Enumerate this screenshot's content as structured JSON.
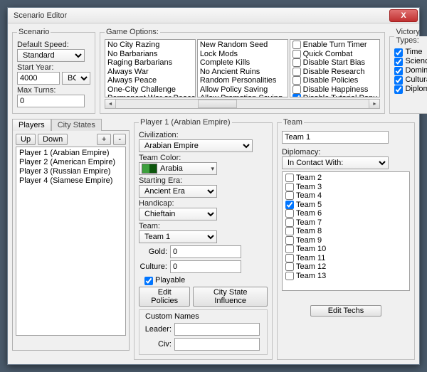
{
  "window": {
    "title": "Scenario Editor",
    "close": "X"
  },
  "scenario": {
    "legend": "Scenario",
    "default_speed_label": "Default Speed:",
    "default_speed": "Standard",
    "start_year_label": "Start Year:",
    "start_year": "4000",
    "era_select": "BC",
    "max_turns_label": "Max Turns:",
    "max_turns": "0"
  },
  "game_options": {
    "legend": "Game Options:",
    "col1": [
      "No City Razing",
      "No Barbarians",
      "Raging Barbarians",
      "Always War",
      "Always Peace",
      "One-City Challenge",
      "Permanent War or Peace"
    ],
    "col2": [
      "New Random Seed",
      "Lock Mods",
      "Complete Kills",
      "No Ancient Ruins",
      "Random Personalities",
      "Allow Policy Saving",
      "Allow Promotion Saving"
    ],
    "col3": [
      {
        "label": "Enable Turn Timer",
        "checked": false
      },
      {
        "label": "Quick Combat",
        "checked": false
      },
      {
        "label": "Disable Start Bias",
        "checked": false
      },
      {
        "label": "Disable Research",
        "checked": false
      },
      {
        "label": "Disable Policies",
        "checked": false
      },
      {
        "label": "Disable Happiness",
        "checked": false
      },
      {
        "label": "Disable Tutorial Popu",
        "checked": true
      }
    ]
  },
  "victory": {
    "legend": "Victory Types:",
    "items": [
      {
        "label": "Time",
        "checked": true
      },
      {
        "label": "Science",
        "checked": true
      },
      {
        "label": "Domination",
        "checked": true
      },
      {
        "label": "Cultural",
        "checked": true
      },
      {
        "label": "Diplomatic",
        "checked": true
      }
    ]
  },
  "players_panel": {
    "tab_players": "Players",
    "tab_citystates": "City States",
    "up": "Up",
    "down": "Down",
    "plus": "+",
    "minus": "-",
    "list": [
      "Player 1 (Arabian Empire)",
      "Player 2 (American Empire)",
      "Player 3 (Russian Empire)",
      "Player 4 (Siamese Empire)"
    ]
  },
  "player_detail": {
    "legend": "Player 1 (Arabian Empire)",
    "civ_label": "Civilization:",
    "civ": "Arabian Empire",
    "teamcolor_label": "Team Color:",
    "teamcolor_name": "Arabia",
    "era_label": "Starting Era:",
    "era": "Ancient Era",
    "handicap_label": "Handicap:",
    "handicap": "Chieftain",
    "team_label": "Team:",
    "team": "Team 1",
    "gold_label": "Gold:",
    "gold": "0",
    "culture_label": "Culture:",
    "culture": "0",
    "playable_label": "Playable",
    "edit_policies": "Edit Policies",
    "city_state_influence": "City State Influence",
    "custom_names": "Custom Names",
    "leader_label": "Leader:",
    "leader": "",
    "civ_name_label": "Civ:",
    "civ_name": ""
  },
  "team_panel": {
    "legend": "Team",
    "team_name": "Team 1",
    "diplomacy_label": "Diplomacy:",
    "diplomacy": "In Contact With:",
    "teams": [
      {
        "label": "Team 2",
        "checked": false
      },
      {
        "label": "Team 3",
        "checked": false
      },
      {
        "label": "Team 4",
        "checked": false
      },
      {
        "label": "Team 5",
        "checked": true
      },
      {
        "label": "Team 6",
        "checked": false
      },
      {
        "label": "Team 7",
        "checked": false
      },
      {
        "label": "Team 8",
        "checked": false
      },
      {
        "label": "Team 9",
        "checked": false
      },
      {
        "label": "Team 10",
        "checked": false
      },
      {
        "label": "Team 11",
        "checked": false
      },
      {
        "label": "Team 12",
        "checked": false
      },
      {
        "label": "Team 13",
        "checked": false
      }
    ],
    "edit_techs": "Edit Techs"
  }
}
